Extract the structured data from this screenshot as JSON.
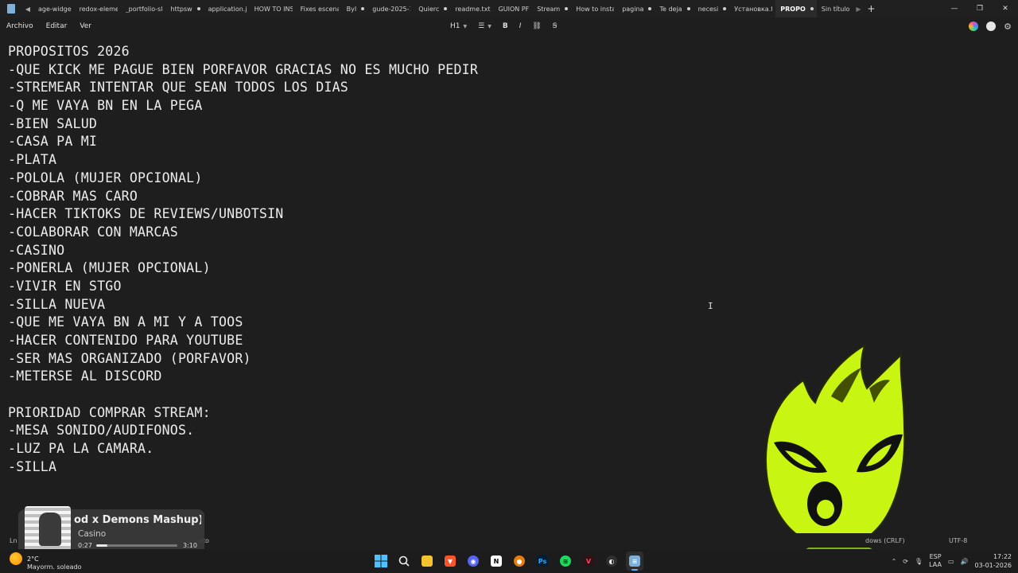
{
  "tabs": [
    {
      "label": "age-widge",
      "dot": false
    },
    {
      "label": "redox-eleme",
      "dot": false
    },
    {
      "label": "_portfolio-sl",
      "dot": false
    },
    {
      "label": "httpsw",
      "dot": true
    },
    {
      "label": "application.j",
      "dot": false
    },
    {
      "label": "HOW TO INS",
      "dot": false
    },
    {
      "label": "Fixes escena",
      "dot": false
    },
    {
      "label": "ByI",
      "dot": true
    },
    {
      "label": "gude-2025-1",
      "dot": false
    },
    {
      "label": "Quierc",
      "dot": true
    },
    {
      "label": "readme.txt",
      "dot": false
    },
    {
      "label": "GUION PF",
      "dot": false
    },
    {
      "label": "Stream",
      "dot": true
    },
    {
      "label": "How to insta",
      "dot": false
    },
    {
      "label": "pagina",
      "dot": true
    },
    {
      "label": "Te deja",
      "dot": true
    },
    {
      "label": "necesi",
      "dot": true
    },
    {
      "label": "Установка.t",
      "dot": false
    },
    {
      "label": "PROPO",
      "dot": true,
      "active": true
    },
    {
      "label": "Sin título",
      "dot": false
    }
  ],
  "menu": {
    "file": "Archivo",
    "edit": "Editar",
    "view": "Ver"
  },
  "toolbar": {
    "heading": "H1",
    "bold": "B",
    "italic": "I"
  },
  "document": {
    "lines": [
      "PROPOSITOS 2026",
      "-QUE KICK ME PAGUE BIEN PORFAVOR GRACIAS NO ES MUCHO PEDIR",
      "-STREMEAR INTENTAR QUE SEAN TODOS LOS DIAS",
      "-Q ME VAYA BN EN LA PEGA",
      "-BIEN SALUD",
      "-CASA PA MI",
      "-PLATA",
      "-POLOLA (MUJER OPCIONAL)",
      "-COBRAR MAS CARO",
      "-HACER TIKTOKS DE REVIEWS/UNBOTSIN",
      "-COLABORAR CON MARCAS",
      "-CASINO",
      "-PONERLA (MUJER OPCIONAL)",
      "-VIVIR EN STGO",
      "-SILLA NUEVA",
      "-QUE ME VAYA BN A MI Y A TOOS",
      "-HACER CONTENIDO PARA YOUTUBE",
      "-SER MAS ORGANIZADO (PORFAVOR)",
      "-METERSE AL DISCORD",
      "",
      "PRIORIDAD COMPRAR STREAM:",
      "-MESA SONIDO/AUDIFONOS.",
      "-LUZ PA LA CAMARA.",
      "-SILLA"
    ]
  },
  "statusbar": {
    "line_col": "Ln",
    "format": "ato",
    "eol": "dows (CRLF)",
    "encoding": "UTF-8"
  },
  "media": {
    "title": "od x Demons Mashup) (",
    "artist": "Casino",
    "time_current": "0:27",
    "time_total": "3:10",
    "progress": 0.14
  },
  "weather": {
    "temp": "2°C",
    "desc": "Mayorm. soleado"
  },
  "tray": {
    "lang_1": "ESP",
    "lang_2": "LAA",
    "time": "17:22",
    "date": "03-01-2026"
  },
  "colors": {
    "mascot": "#c9f512",
    "accent": "#5ab0ff",
    "background": "#1e1e1e"
  }
}
